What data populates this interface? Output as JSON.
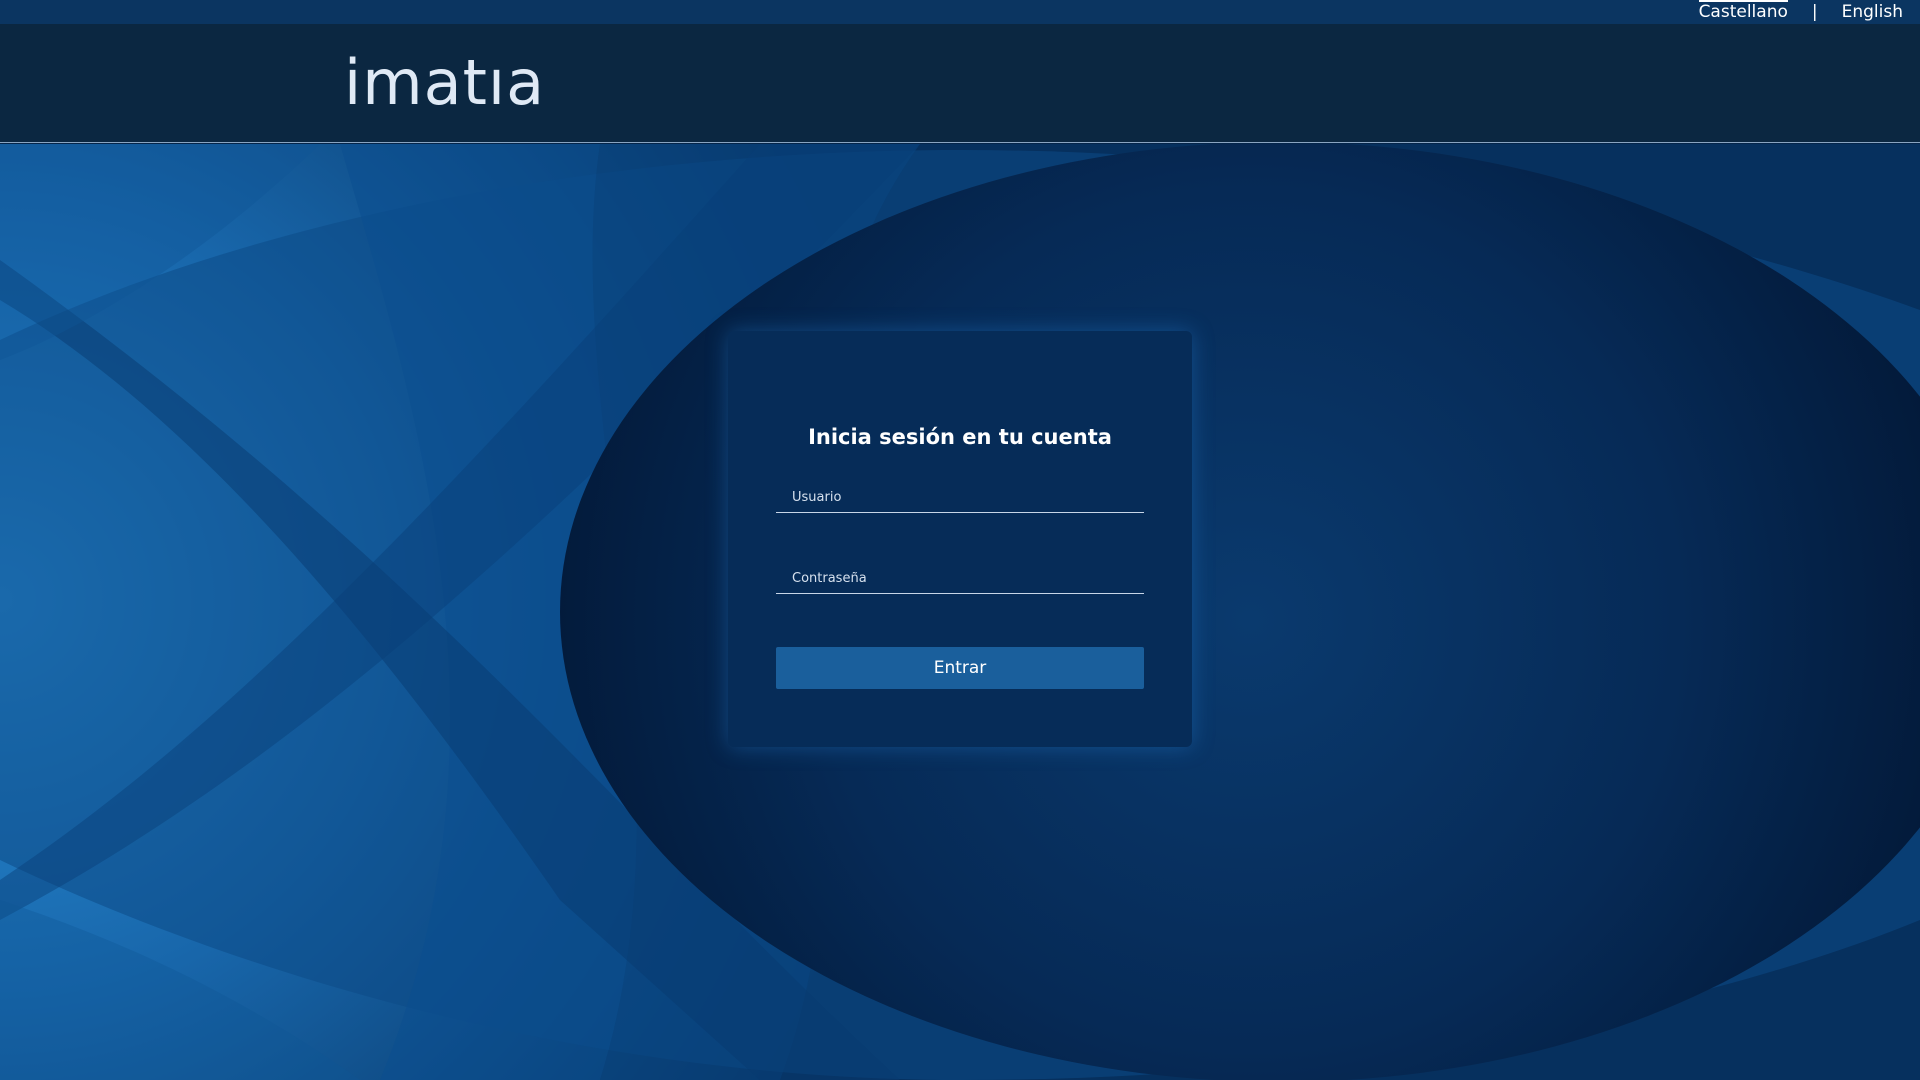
{
  "language_bar": {
    "languages": [
      {
        "label": "Castellano",
        "active": true
      },
      {
        "label": "English",
        "active": false
      }
    ],
    "separator": "|"
  },
  "header": {
    "logo_text": "imatıa"
  },
  "login_form": {
    "title": "Inicia sesión en tu cuenta",
    "username_placeholder": "Usuario",
    "password_placeholder": "Contraseña",
    "submit_label": "Entrar"
  },
  "colors": {
    "language_bar": "#0b3561",
    "header": "#0b2741",
    "card": "#062c58",
    "button": "#1a5f9c",
    "background_light": "#2a8ad4",
    "background_dark": "#021a3a"
  }
}
